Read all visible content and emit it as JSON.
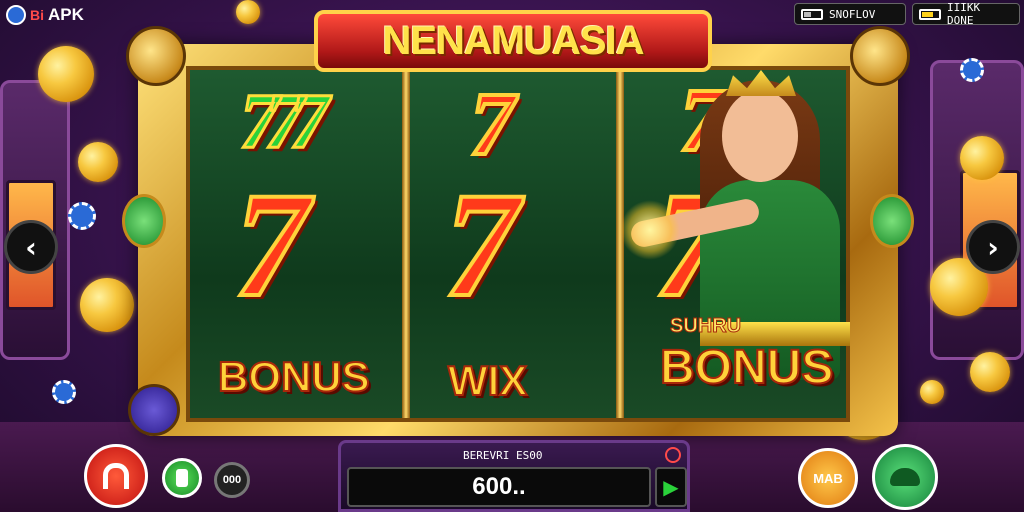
{
  "app": {
    "logo_text": "APK",
    "logo_prefix": "Bi"
  },
  "status_left": {
    "text": "SNOFLOV"
  },
  "status_right": {
    "text": "IIIKK DONE"
  },
  "game": {
    "title": "NENAMUASIA"
  },
  "reels": [
    {
      "top": "777",
      "middle": "7",
      "bottom": "BONUS"
    },
    {
      "top": "7",
      "middle": "7",
      "bottom": "WIX"
    },
    {
      "top": "7",
      "middle": "7",
      "bottom_small": "SUHRU",
      "bottom": "BONUS"
    }
  ],
  "nav": {
    "prev": "‹",
    "next": "›"
  },
  "controls": {
    "home_icon": "home-icon",
    "bet_icon": "coin-stack-icon",
    "auto_label": "000",
    "bet_title": "BEREVRI ES00",
    "bet_value": "600..",
    "max_label": "MAB",
    "spin_icon": "turtle-icon"
  },
  "colors": {
    "frame": "#d9a22c",
    "banner": "#c81e1e",
    "seven": "#ff3a1a",
    "reel": "#1e5a30"
  }
}
